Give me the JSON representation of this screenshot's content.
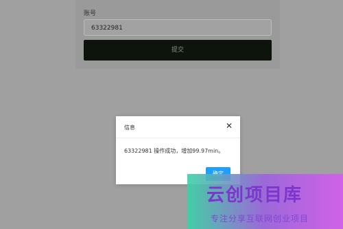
{
  "form": {
    "account_label": "账号",
    "account_value": "63322981",
    "submit_label": "提交"
  },
  "dialog": {
    "title": "信息",
    "close_icon": "close-icon",
    "message": "63322981 操作成功，增加99.97min。",
    "confirm_label": "确定"
  },
  "watermark": {
    "title": "云创项目库",
    "subtitle": "专注分享互联网创业项目"
  },
  "colors": {
    "overlay": "#a0a0a0",
    "submit_bg": "#0c140c",
    "confirm_bg": "#1e9fff",
    "dialog_bg": "#ffffff"
  }
}
